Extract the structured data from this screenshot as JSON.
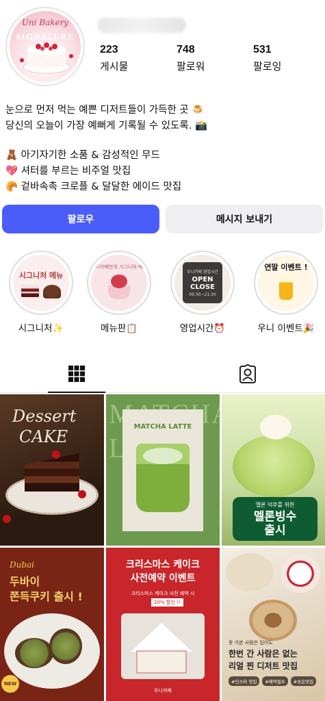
{
  "profile": {
    "avatar": {
      "brand": "Uni Bakery",
      "word": "SIGNATURE"
    },
    "stats": [
      {
        "value": "223",
        "label": "게시물"
      },
      {
        "value": "748",
        "label": "팔로워"
      },
      {
        "value": "531",
        "label": "팔로잉"
      }
    ]
  },
  "bio": {
    "lines": [
      "눈으로 먼저 먹는 예쁜 디저트들이 가득한 곳 🍮",
      "당신의 오늘이 가장 예뻐게 기록될 수 있도록. 📸",
      "🧸 아기자기한 소품 & 감성적인 무드",
      "💖 셔터를 부르는 비주얼 맛집",
      "🥐 겉바속촉 크로플 & 달달한 에이드 맛집"
    ]
  },
  "buttons": {
    "follow": "팔로우",
    "message": "메시지 보내기"
  },
  "highlights": [
    {
      "label": "시그니처✨",
      "cover": {
        "title": "시그니처 메뉴"
      }
    },
    {
      "label": "메뉴판📋",
      "cover": {
        "title": "우니카페만의 시그니처 메뉴"
      }
    },
    {
      "label": "영업시간⏰",
      "cover": {
        "small": "우니카페 영업시간",
        "open": "OPEN",
        "close": "CLOSE",
        "time": "09:30~21:30"
      }
    },
    {
      "label": "우니 이벤트🎉",
      "cover": {
        "title": "연말 이벤트 !"
      }
    }
  ],
  "tabs": {
    "grid_icon": "grid-icon",
    "tagged_icon": "tagged-person-icon"
  },
  "posts": [
    {
      "line1": "Dessert",
      "line2": "CAKE"
    },
    {
      "bg": "MATCHA LATTE",
      "title": "MATCHA LATTE"
    },
    {
      "small": "멜론 덕후를 위한",
      "big": "멜론빙수",
      "big2": "출시"
    },
    {
      "script": "Dubai",
      "line1": "두바이",
      "line2": "쫀득쿠키 출시 !",
      "badge": "NEW"
    },
    {
      "line1": "크리스마스 케이크",
      "line2": "사전예약 이벤트",
      "sub": "크리스마스 케이크 사전 예약 시",
      "tag": "20% 할인 !!",
      "foot": "우니카페"
    },
    {
      "line1": "못 가본 사람은 있어도",
      "line2": "한번 간 사람은 없는",
      "line3": "리얼 찐 디저트 맛집",
      "tags": [
        "#인스타 맛집",
        "#예약필수",
        "#송은맛집"
      ]
    }
  ]
}
